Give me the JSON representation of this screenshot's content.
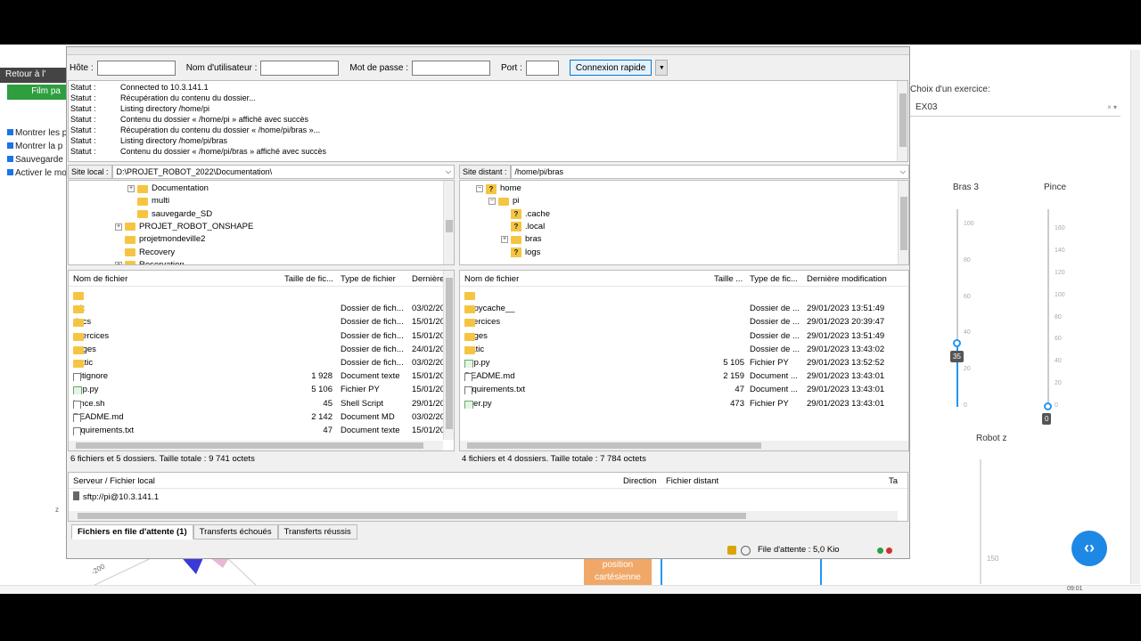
{
  "background_page": {
    "retour_label": "Retour à l'",
    "film_label": "Film pa",
    "checks": [
      "Montrer les p",
      "Montrer la p",
      "Sauvegarde",
      "Activer le mo"
    ],
    "exercise_label": "Choix d'un exercice:",
    "exercise_value": "EX03",
    "bras3_label": "Bras 3",
    "pince_label": "Pince",
    "bras3_ticks": [
      "100",
      "80",
      "60",
      "40",
      "20",
      "0"
    ],
    "pince_ticks": [
      "160",
      "140",
      "120",
      "100",
      "80",
      "60",
      "40",
      "20",
      "0"
    ],
    "bras3_value": "35",
    "pince_value": "0",
    "robot_z_label": "Robot z",
    "tick_150": "150",
    "position_btn": "position\ncartésienne",
    "axis_200": "-200",
    "axis_z": "z",
    "time_text": "09:01"
  },
  "quickconnect": {
    "host_label": "Hôte :",
    "user_label": "Nom d'utilisateur :",
    "pass_label": "Mot de passe :",
    "port_label": "Port :",
    "host_value": "",
    "user_value": "",
    "pass_value": "",
    "port_value": "",
    "connect_label": "Connexion rapide"
  },
  "log": [
    {
      "k": "Statut :",
      "v": "Connected to 10.3.141.1"
    },
    {
      "k": "Statut :",
      "v": "Récupération du contenu du dossier..."
    },
    {
      "k": "Statut :",
      "v": "Listing directory /home/pi"
    },
    {
      "k": "Statut :",
      "v": "Contenu du dossier « /home/pi » affiché avec succès"
    },
    {
      "k": "Statut :",
      "v": "Récupération du contenu du dossier « /home/pi/bras »..."
    },
    {
      "k": "Statut :",
      "v": "Listing directory /home/pi/bras"
    },
    {
      "k": "Statut :",
      "v": "Contenu du dossier « /home/pi/bras » affiché avec succès"
    }
  ],
  "local": {
    "site_label": "Site local :",
    "path": "D:\\PROJET_ROBOT_2022\\Documentation\\",
    "tree": [
      {
        "label": "Documentation",
        "indent": 2,
        "expand": "+"
      },
      {
        "label": "multi",
        "indent": 2,
        "expand": ""
      },
      {
        "label": "sauvegarde_SD",
        "indent": 2,
        "expand": ""
      },
      {
        "label": "PROJET_ROBOT_ONSHAPE",
        "indent": 1,
        "expand": "+"
      },
      {
        "label": "projetmondeville2",
        "indent": 1,
        "expand": ""
      },
      {
        "label": "Recovery",
        "indent": 1,
        "expand": ""
      },
      {
        "label": "Reservation",
        "indent": 1,
        "expand": "+"
      }
    ],
    "headers": [
      "Nom de fichier",
      "Taille de fic...",
      "Type de fichier",
      "Dernière"
    ],
    "files": [
      {
        "name": "..",
        "size": "",
        "type": "",
        "date": "",
        "icon": "folder"
      },
      {
        "name": ".git",
        "size": "",
        "type": "Dossier de fich...",
        "date": "03/02/20",
        "icon": "folder"
      },
      {
        "name": "docs",
        "size": "",
        "type": "Dossier de fich...",
        "date": "15/01/20",
        "icon": "folder"
      },
      {
        "name": "exercices",
        "size": "",
        "type": "Dossier de fich...",
        "date": "15/01/20",
        "icon": "folder"
      },
      {
        "name": "pages",
        "size": "",
        "type": "Dossier de fich...",
        "date": "24/01/20",
        "icon": "folder"
      },
      {
        "name": "static",
        "size": "",
        "type": "Dossier de fich...",
        "date": "03/02/20",
        "icon": "folder"
      },
      {
        "name": ".gitignore",
        "size": "1 928",
        "type": "Document texte",
        "date": "15/01/20",
        "icon": "file"
      },
      {
        "name": "app.py",
        "size": "5 106",
        "type": "Fichier PY",
        "date": "15/01/20",
        "icon": "py"
      },
      {
        "name": "lance.sh",
        "size": "45",
        "type": "Shell Script",
        "date": "29/01/20",
        "icon": "file"
      },
      {
        "name": "README.md",
        "size": "2 142",
        "type": "Document MD",
        "date": "03/02/20",
        "icon": "file"
      },
      {
        "name": "requirements.txt",
        "size": "47",
        "type": "Document texte",
        "date": "15/01/20",
        "icon": "file"
      }
    ],
    "status": "6 fichiers et 5 dossiers. Taille totale : 9 741 octets"
  },
  "remote": {
    "site_label": "Site distant :",
    "path": "/home/pi/bras",
    "tree": [
      {
        "label": "home",
        "indent": 0,
        "expand": "−",
        "q": true
      },
      {
        "label": "pi",
        "indent": 1,
        "expand": "−",
        "q": false
      },
      {
        "label": ".cache",
        "indent": 2,
        "expand": "",
        "q": true
      },
      {
        "label": ".local",
        "indent": 2,
        "expand": "",
        "q": true
      },
      {
        "label": "bras",
        "indent": 2,
        "expand": "+",
        "q": false
      },
      {
        "label": "logs",
        "indent": 2,
        "expand": "",
        "q": true
      }
    ],
    "headers": [
      "Nom de fichier",
      "Taille ...",
      "Type de fic...",
      "Dernière modification"
    ],
    "files": [
      {
        "name": "..",
        "size": "",
        "type": "",
        "date": "",
        "icon": "folder"
      },
      {
        "name": "__pycache__",
        "size": "",
        "type": "Dossier de ...",
        "date": "29/01/2023 13:51:49",
        "icon": "folder"
      },
      {
        "name": "exercices",
        "size": "",
        "type": "Dossier de ...",
        "date": "29/01/2023 20:39:47",
        "icon": "folder"
      },
      {
        "name": "pages",
        "size": "",
        "type": "Dossier de ...",
        "date": "29/01/2023 13:51:49",
        "icon": "folder"
      },
      {
        "name": "static",
        "size": "",
        "type": "Dossier de ...",
        "date": "29/01/2023 13:43:02",
        "icon": "folder"
      },
      {
        "name": "app.py",
        "size": "5 105",
        "type": "Fichier PY",
        "date": "29/01/2023 13:52:52",
        "icon": "py"
      },
      {
        "name": "README.md",
        "size": "2 159",
        "type": "Document ...",
        "date": "29/01/2023 13:43:01",
        "icon": "file"
      },
      {
        "name": "requirements.txt",
        "size": "47",
        "type": "Document ...",
        "date": "29/01/2023 13:43:01",
        "icon": "file"
      },
      {
        "name": "user.py",
        "size": "473",
        "type": "Fichier PY",
        "date": "29/01/2023 13:43:01",
        "icon": "py"
      }
    ],
    "status": "4 fichiers et 4 dossiers. Taille totale : 7 784 octets"
  },
  "queue": {
    "headers": [
      "Serveur / Fichier local",
      "Direction",
      "Fichier distant",
      "Ta"
    ],
    "row": "sftp://pi@10.3.141.1",
    "tabs": [
      "Fichiers en file d'attente (1)",
      "Transferts échoués",
      "Transferts réussis"
    ],
    "file_attente": "File d'attente : 5,0 Kio"
  },
  "colors": {
    "accent": "#0078d7",
    "folder": "#f5c542",
    "fab": "#1e88e5"
  }
}
